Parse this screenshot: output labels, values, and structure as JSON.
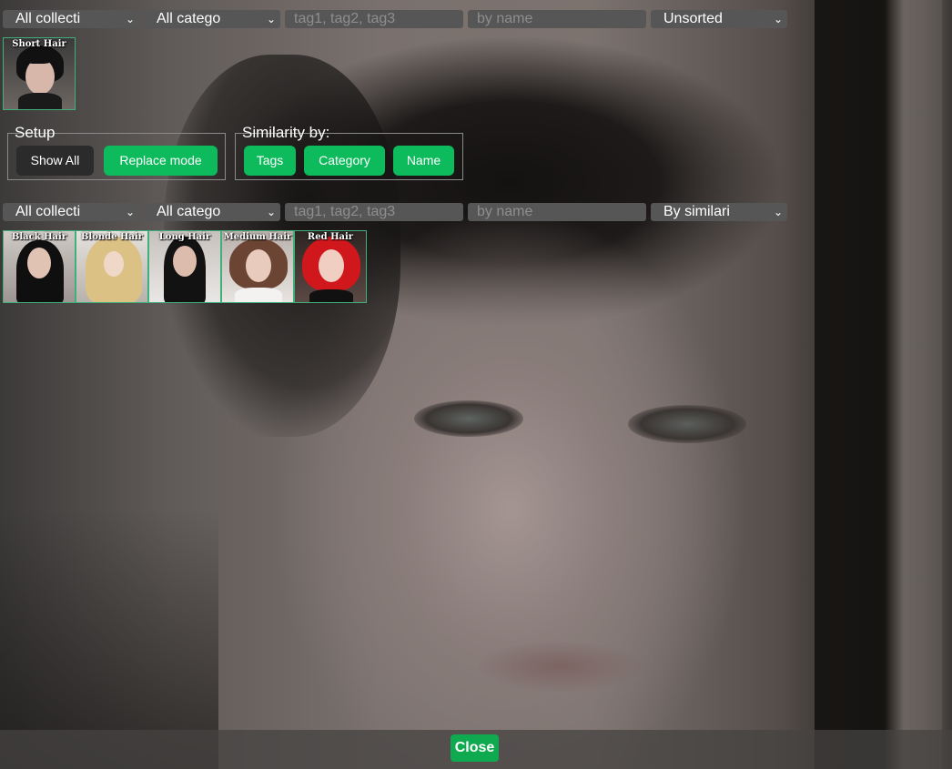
{
  "filters_top": {
    "collection": "All collecti",
    "category": "All catego",
    "tags_placeholder": "tag1, tag2, tag3",
    "name_placeholder": "by name",
    "sort": "Unsorted"
  },
  "selected_items": [
    {
      "label": "Short Hair"
    }
  ],
  "setup": {
    "legend": "Setup",
    "show_all_label": "Show All",
    "replace_mode_label": "Replace mode"
  },
  "similarity": {
    "legend": "Similarity by:",
    "tags_label": "Tags",
    "category_label": "Category",
    "name_label": "Name"
  },
  "filters_similar": {
    "collection": "All collecti",
    "category": "All catego",
    "tags_placeholder": "tag1, tag2, tag3",
    "name_placeholder": "by name",
    "sort": "By similari"
  },
  "similar_items": [
    {
      "label": "Black Hair"
    },
    {
      "label": "Blonde Hair"
    },
    {
      "label": "Long Hair"
    },
    {
      "label": "Medium Hair"
    },
    {
      "label": "Red Hair"
    }
  ],
  "footer": {
    "close_label": "Close"
  },
  "colors": {
    "accent_green": "#0dbb5c",
    "thumb_border": "#3fb07a",
    "control_bg": "#565656"
  },
  "icons": {
    "dropdown": "chevron-down-icon"
  }
}
